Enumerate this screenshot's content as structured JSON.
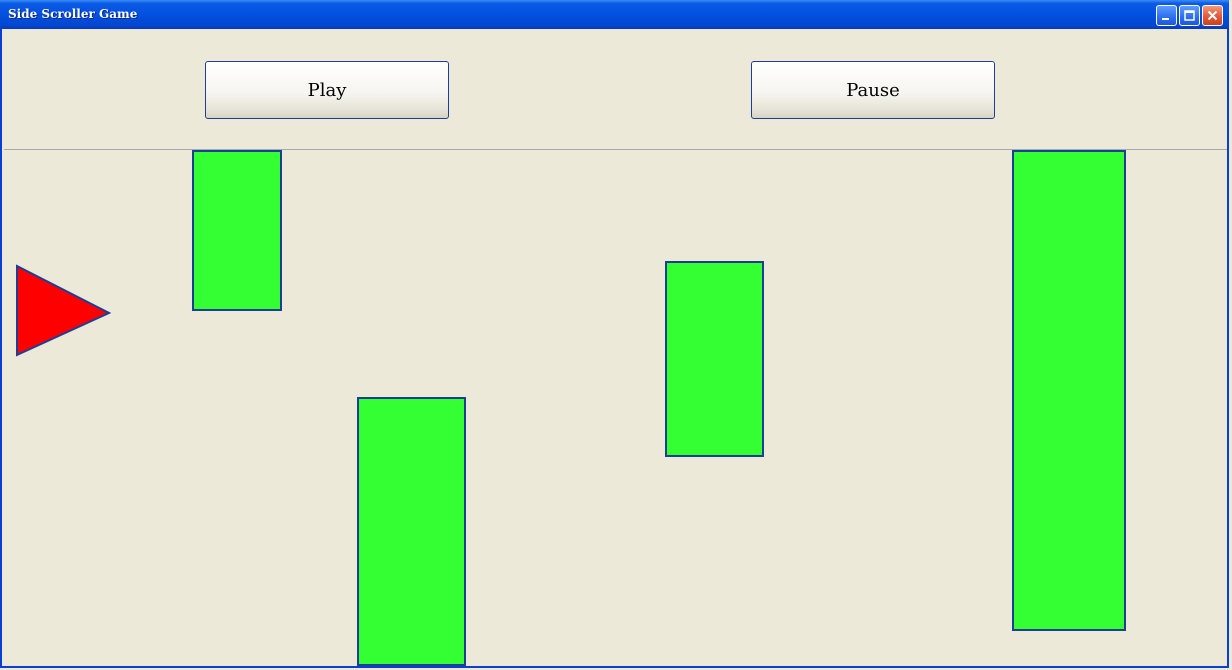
{
  "window": {
    "title": "Side Scroller Game"
  },
  "controls": {
    "play_label": "Play",
    "pause_label": "Pause"
  },
  "colors": {
    "obstacle_fill": "#33ff33",
    "obstacle_stroke": "#1c3f94",
    "player_fill": "#ff0000",
    "player_stroke": "#1c3f94",
    "background": "#ece9d8"
  }
}
